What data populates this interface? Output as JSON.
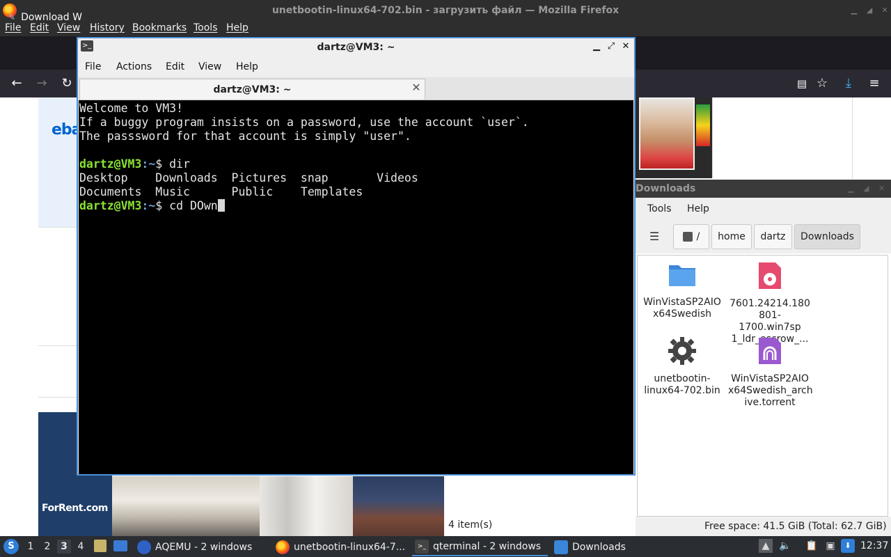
{
  "firefox": {
    "title": "unetbootin-linux64-702.bin - загрузить файл — Mozilla Firefox",
    "menu": [
      "File",
      "Edit",
      "View",
      "History",
      "Bookmarks",
      "Tools",
      "Help"
    ],
    "tab_label": "Download W",
    "ad_logo_ebay": "eba",
    "ad_logo_forrent": "ForRent.com"
  },
  "terminal": {
    "title": "dartz@VM3: ~",
    "tab_title": "dartz@VM3: ~",
    "menu": [
      "File",
      "Actions",
      "Edit",
      "View",
      "Help"
    ],
    "lines": [
      "Welcome to VM3!",
      "If a buggy program insists on a password, use the account `user`.",
      "The passsword for that account is simply \"user\".",
      ""
    ],
    "prompt_user": "dartz@VM3",
    "prompt_path": ":~",
    "prompt_symbol": "$ ",
    "command1": "dir",
    "dir_output": [
      "Desktop    Downloads  Pictures  snap       Videos",
      "Documents  Music      Public    Templates"
    ],
    "command2": "cd DOwn"
  },
  "file_manager": {
    "title": "Downloads",
    "menu": [
      "Tools",
      "Help"
    ],
    "breadcrumb": [
      "/",
      "home",
      "dartz",
      "Downloads"
    ],
    "items": [
      {
        "name": "WinVistaSP2AIO x64Swedish",
        "icon": "folder-icon"
      },
      {
        "name": "7601.24214.180 801-1700.win7sp 1_ldr_escrow_...",
        "icon": "disc-image-icon"
      },
      {
        "name": "unetbootin-linux64-702.bin",
        "icon": "executable-gear-icon"
      },
      {
        "name": "WinVistaSP2AIO x64Swedish_arch ive.torrent",
        "icon": "torrent-icon"
      }
    ],
    "item_count": "4 item(s)",
    "free_space": "Free space: 41.5 GiB (Total: 62.7 GiB)"
  },
  "taskbar": {
    "workspaces": [
      "1",
      "2",
      "3",
      "4"
    ],
    "tasks": [
      {
        "label": "AQEMU - 2 windows"
      },
      {
        "label": "unetbootin-linux64-7..."
      },
      {
        "label": "qterminal - 2 windows"
      },
      {
        "label": "Downloads"
      }
    ],
    "clock": "12:37"
  },
  "colors": {
    "prompt_user": "#8ae234",
    "prompt_path": "#729fcf",
    "active_window_border": "#4a8fd6"
  }
}
